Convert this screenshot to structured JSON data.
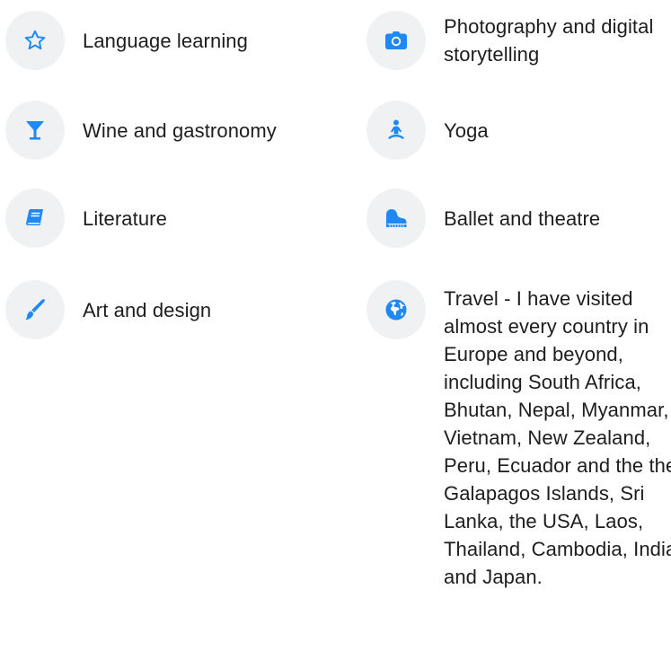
{
  "colors": {
    "accent": "#1e88f5",
    "icon_bg": "#f0f1f3",
    "text": "#1d1d1f"
  },
  "interests": {
    "left": [
      {
        "icon": "star-icon",
        "label": "Language learning"
      },
      {
        "icon": "cocktail-glass-icon",
        "label": "Wine and gastronomy"
      },
      {
        "icon": "book-icon",
        "label": "Literature"
      },
      {
        "icon": "paintbrush-icon",
        "label": "Art and design"
      }
    ],
    "right": [
      {
        "icon": "camera-icon",
        "label": "Photography and digital storytelling"
      },
      {
        "icon": "yoga-icon",
        "label": "Yoga"
      },
      {
        "icon": "piano-icon",
        "label": "Ballet and theatre"
      },
      {
        "icon": "globe-icon",
        "label": "Travel - I have visited almost every country in Europe and beyond, including South Africa, Bhutan, Nepal, Myanmar, Vietnam, New Zealand, Peru, Ecuador and the the Galapagos Islands, Sri Lanka, the USA, Laos, Thailand, Cambodia, India and Japan."
      }
    ]
  }
}
